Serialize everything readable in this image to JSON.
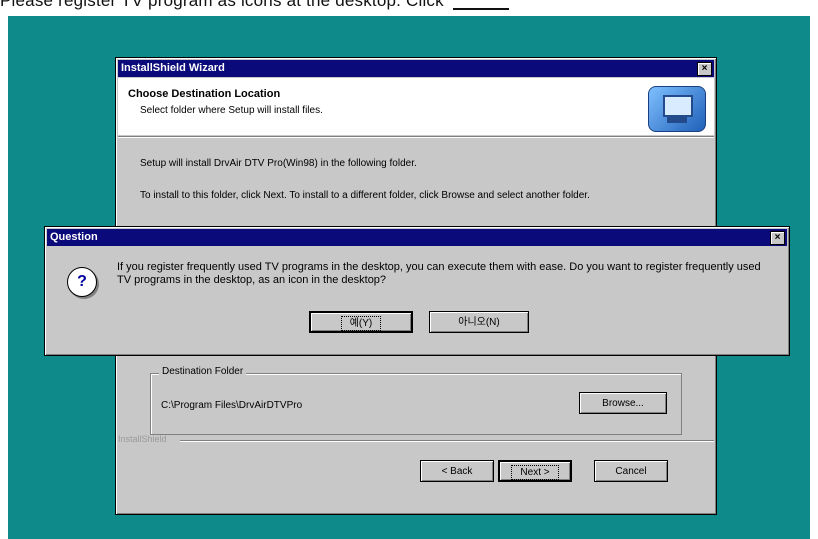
{
  "caption": {
    "text": "Please register TV program as icons at the desktop. Click"
  },
  "wizard": {
    "title": "InstallShield Wizard",
    "close_glyph": "×",
    "header_title": "Choose Destination Location",
    "header_subtitle": "Select folder where Setup will install files.",
    "icon": "setup-computer-icon",
    "body_line1": "Setup will install DrvAir DTV Pro(Win98) in the following folder.",
    "body_line2": "To install to this folder, click Next. To install to a different folder, click Browse and select another folder.",
    "dest_group_label": "Destination Folder",
    "dest_path": "C:\\Program Files\\DrvAirDTVPro",
    "browse_label": "Browse...",
    "installshield_label": "InstallShield",
    "back_label": "< Back",
    "next_label": "Next >",
    "cancel_label": "Cancel"
  },
  "question": {
    "title": "Question",
    "close_glyph": "×",
    "icon": "question-icon",
    "icon_glyph": "?",
    "message": "If you register frequently used TV programs in the desktop, you can execute them with ease. Do you want to register frequently used TV programs in the desktop, as an icon in the desktop?",
    "yes_label": "예(Y)",
    "no_label": "아니오(N)"
  },
  "colors": {
    "desktop": "#0f8a8a",
    "titlebar": "#0a0a7a",
    "dialog_face": "#c8c8c8"
  }
}
